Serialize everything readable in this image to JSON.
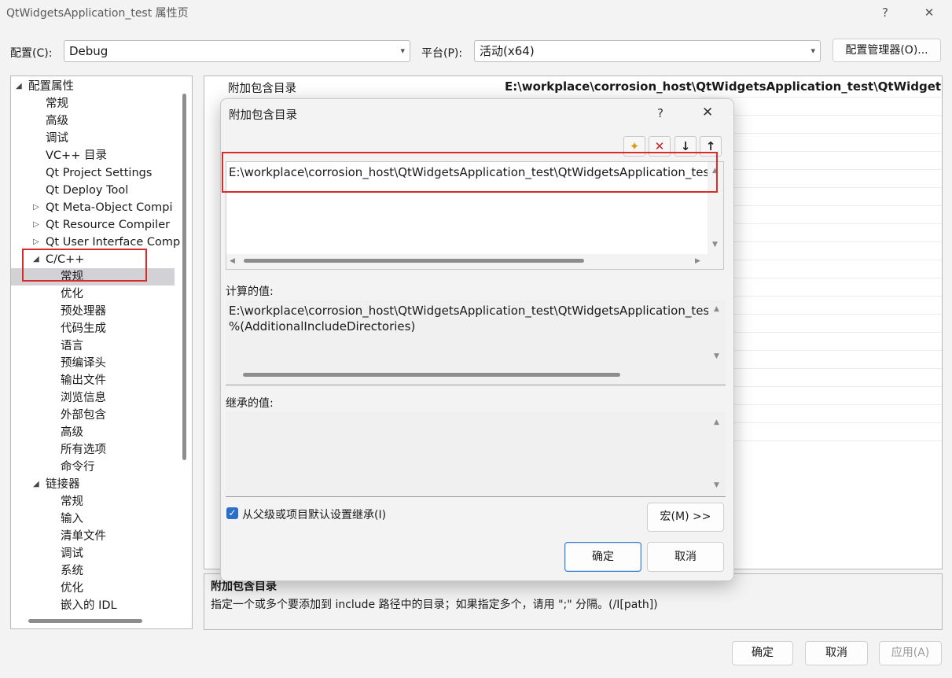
{
  "window": {
    "title": "QtWidgetsApplication_test 属性页",
    "help": "?",
    "close": "✕"
  },
  "config_row": {
    "config_label": "配置(C):",
    "config_value": "Debug",
    "platform_label": "平台(P):",
    "platform_value": "活动(x64)",
    "manager_button": "配置管理器(O)..."
  },
  "tree": {
    "items": [
      {
        "label": "配置属性",
        "level": 0,
        "expander": "◢"
      },
      {
        "label": "常规",
        "level": 1
      },
      {
        "label": "高级",
        "level": 1
      },
      {
        "label": "调试",
        "level": 1
      },
      {
        "label": "VC++ 目录",
        "level": 1
      },
      {
        "label": "Qt Project Settings",
        "level": 1
      },
      {
        "label": "Qt Deploy Tool",
        "level": 1
      },
      {
        "label": "Qt Meta-Object Compi",
        "level": 1,
        "expander": "▷"
      },
      {
        "label": "Qt Resource Compiler",
        "level": 1,
        "expander": "▷"
      },
      {
        "label": "Qt User Interface Comp",
        "level": 1,
        "expander": "▷"
      },
      {
        "label": "C/C++",
        "level": 1,
        "expander": "◢"
      },
      {
        "label": "常规",
        "level": 2,
        "selected": true
      },
      {
        "label": "优化",
        "level": 2
      },
      {
        "label": "预处理器",
        "level": 2
      },
      {
        "label": "代码生成",
        "level": 2
      },
      {
        "label": "语言",
        "level": 2
      },
      {
        "label": "预编译头",
        "level": 2
      },
      {
        "label": "输出文件",
        "level": 2
      },
      {
        "label": "浏览信息",
        "level": 2
      },
      {
        "label": "外部包含",
        "level": 2
      },
      {
        "label": "高级",
        "level": 2
      },
      {
        "label": "所有选项",
        "level": 2
      },
      {
        "label": "命令行",
        "level": 2
      },
      {
        "label": "链接器",
        "level": 1,
        "expander": "◢"
      },
      {
        "label": "常规",
        "level": 2
      },
      {
        "label": "输入",
        "level": 2
      },
      {
        "label": "清单文件",
        "level": 2
      },
      {
        "label": "调试",
        "level": 2
      },
      {
        "label": "系统",
        "level": 2
      },
      {
        "label": "优化",
        "level": 2
      },
      {
        "label": "嵌入的 IDL",
        "level": 2
      }
    ]
  },
  "grid": {
    "property_name": "附加包含目录",
    "property_value": "E:\\workplace\\corrosion_host\\QtWidgetsApplication_test\\QtWidgetsApplic"
  },
  "description": {
    "title": "附加包含目录",
    "text": "指定一个或多个要添加到 include 路径中的目录；如果指定多个，请用 \";\" 分隔。(/I[path])"
  },
  "dialog": {
    "title": "附加包含目录",
    "help": "?",
    "close": "✕",
    "toolbar": {
      "new_line": "✦",
      "delete": "✕",
      "move_down": "↓",
      "move_up": "↑"
    },
    "edit_lines": [
      "E:\\workplace\\corrosion_host\\QtWidgetsApplication_test\\QtWidgetsApplication_tes"
    ],
    "evaluated_label": "计算的值:",
    "evaluated_lines": [
      "E:\\workplace\\corrosion_host\\QtWidgetsApplication_test\\QtWidgetsApplication_tes",
      "%(AdditionalIncludeDirectories)"
    ],
    "inherited_label": "继承的值:",
    "inherit_checkbox_label": "从父级或项目默认设置继承(I)",
    "inherit_checked": true,
    "macros_button": "宏(M) >>",
    "ok_button": "确定",
    "cancel_button": "取消"
  },
  "footer": {
    "ok_button": "确定",
    "cancel_button": "取消",
    "apply_button": "应用(A)"
  },
  "colors": {
    "highlight_box": "#d92b2b",
    "checkbox": "#2a6fc9",
    "selection": "#d1d1d6"
  }
}
